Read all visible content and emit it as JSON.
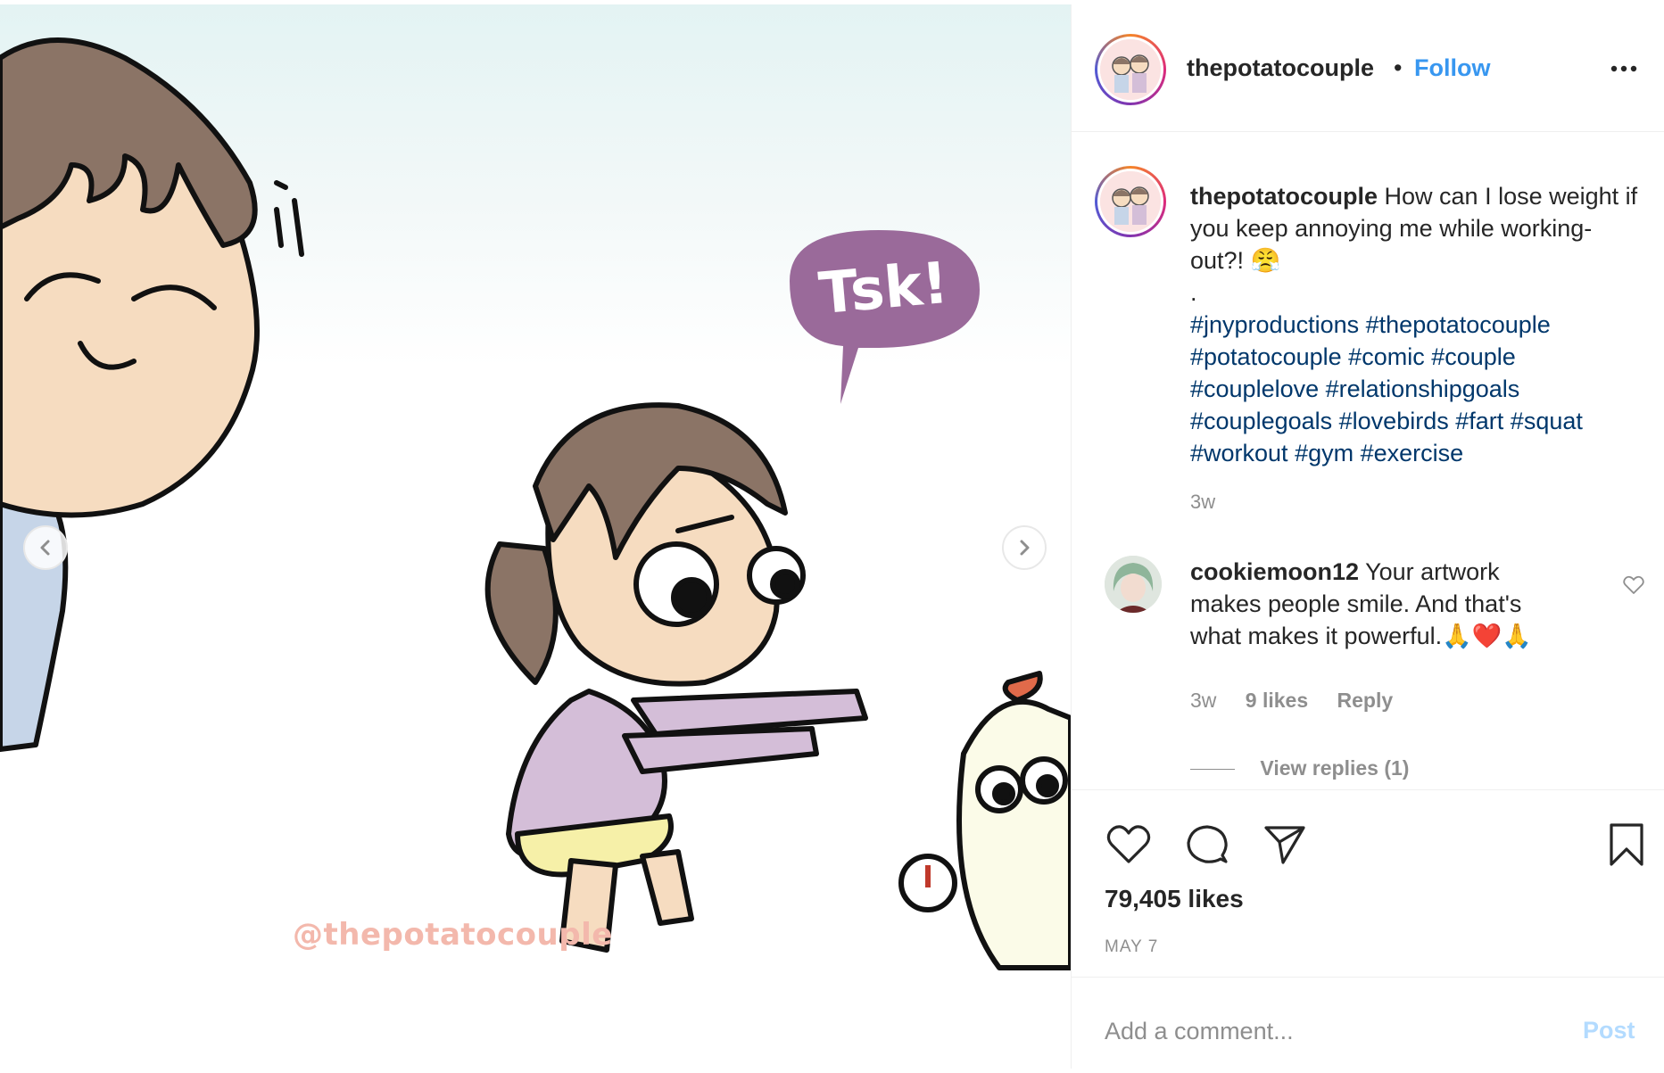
{
  "post": {
    "watermark": "@thepotatocouple",
    "speech_bubble": "Tsk!",
    "nav": {
      "prev_icon": "chevron-left-icon",
      "next_icon": "chevron-right-icon"
    }
  },
  "header": {
    "username": "thepotatocouple",
    "separator": "•",
    "follow_label": "Follow",
    "more_icon": "more-horizontal-icon"
  },
  "caption": {
    "username": "thepotatocouple",
    "text": "How can I lose weight if you keep annoying me while working-out?! 😤",
    "dot": ".",
    "hashtags": [
      "#jnyproductions",
      "#thepotatocouple",
      "#potatocouple",
      "#comic",
      "#couple",
      "#couplelove",
      "#relationshipgoals",
      "#couplegoals",
      "#lovebirds",
      "#fart",
      "#squat",
      "#workout",
      "#gym",
      "#exercise"
    ],
    "time": "3w"
  },
  "comment": {
    "username": "cookiemoon12",
    "text": "Your artwork makes people smile. And that's what makes it powerful.🙏❤️🙏",
    "time": "3w",
    "likes": "9 likes",
    "reply_label": "Reply",
    "view_replies": "View replies (1)"
  },
  "actions": {
    "likes_count": "79,405 likes",
    "date": "MAY 7"
  },
  "add_comment": {
    "placeholder": "Add a comment...",
    "post_label": "Post"
  },
  "colors": {
    "accent": "#3897f0",
    "hashtag": "#00376b",
    "muted": "#8e8e8e",
    "post_disabled": "#b3dbff"
  }
}
